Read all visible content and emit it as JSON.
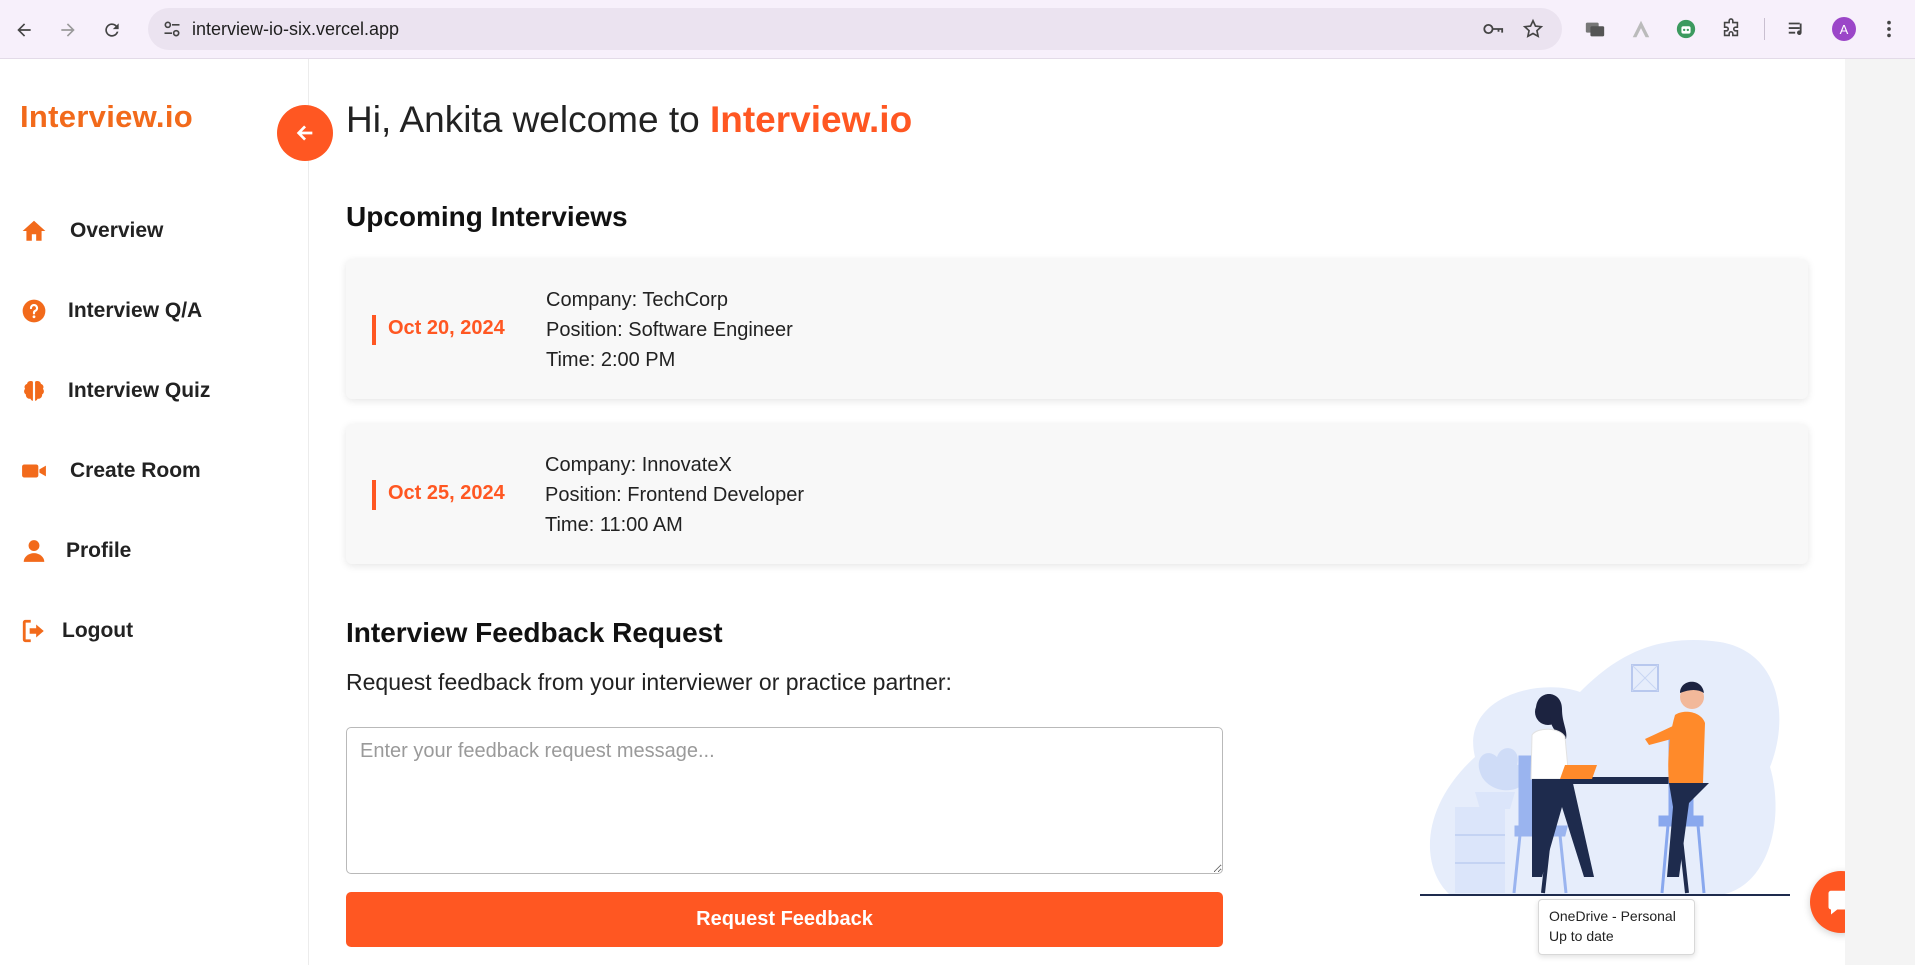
{
  "browser": {
    "url": "interview-io-six.vercel.app",
    "profile_initial": "A"
  },
  "brand": {
    "name": "Interview.io",
    "color": "#f26a1b"
  },
  "sidebar": {
    "items": [
      {
        "label": "Overview",
        "icon": "home-icon"
      },
      {
        "label": "Interview Q/A",
        "icon": "question-circle-icon"
      },
      {
        "label": "Interview Quiz",
        "icon": "brain-icon"
      },
      {
        "label": "Create Room",
        "icon": "video-camera-icon"
      },
      {
        "label": "Profile",
        "icon": "user-icon"
      },
      {
        "label": "Logout",
        "icon": "logout-icon"
      }
    ]
  },
  "header": {
    "greeting_prefix": "Hi, Ankita welcome to ",
    "greeting_brand": "Interview.io"
  },
  "upcoming": {
    "title": "Upcoming Interviews",
    "items": [
      {
        "date": "Oct 20, 2024",
        "company": "Company: TechCorp",
        "position": "Position: Software Engineer",
        "time": "Time: 2:00 PM"
      },
      {
        "date": "Oct 25, 2024",
        "company": "Company: InnovateX",
        "position": "Position: Frontend Developer",
        "time": "Time: 11:00 AM"
      }
    ]
  },
  "feedback": {
    "title": "Interview Feedback Request",
    "description": "Request feedback from your interviewer or practice partner:",
    "placeholder": "Enter your feedback request message...",
    "value": "",
    "button_label": "Request Feedback"
  },
  "toast": {
    "line1": "OneDrive - Personal",
    "line2": "Up to date"
  },
  "colors": {
    "accent": "#ff5722",
    "chrome_bg": "#f7f0fb",
    "card_bg": "#f8f8f8"
  }
}
